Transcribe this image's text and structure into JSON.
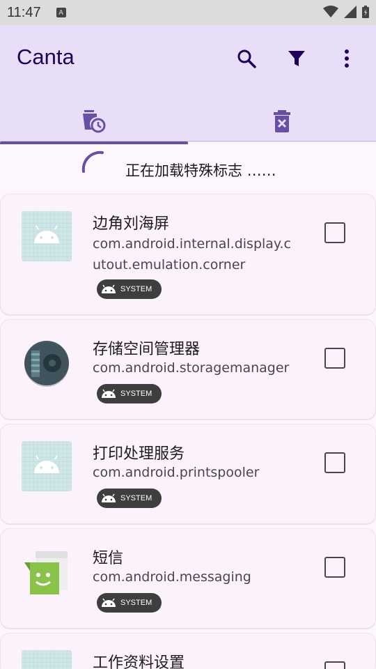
{
  "status_bar": {
    "time": "11:47",
    "notification_letter": "A"
  },
  "app_bar": {
    "title": "Canta",
    "actions": [
      "search-icon",
      "filter-icon",
      "more-vert-icon"
    ]
  },
  "tabs": [
    {
      "icon": "uninstall-scheduled-icon",
      "selected": true
    },
    {
      "icon": "delete-x-icon",
      "selected": false
    }
  ],
  "loading": {
    "text": "正在加载特殊标志 ……"
  },
  "apps": [
    {
      "name": "边角刘海屏",
      "package": "com.android.internal.display.cutout.emulation.corner",
      "badge": "SYSTEM",
      "icon": "android-default-icon",
      "checked": false
    },
    {
      "name": "存储空间管理器",
      "package": "com.android.storagemanager",
      "badge": "SYSTEM",
      "icon": "storage-manager-icon",
      "checked": false
    },
    {
      "name": "打印处理服务",
      "package": "com.android.printspooler",
      "badge": "SYSTEM",
      "icon": "android-default-icon",
      "checked": false
    },
    {
      "name": "短信",
      "package": "com.android.messaging",
      "badge": "SYSTEM",
      "icon": "messaging-icon",
      "checked": false
    },
    {
      "name": "工作资料设置",
      "package": "",
      "badge": "",
      "icon": "android-default-icon",
      "checked": false
    }
  ],
  "colors": {
    "app_bar": "#e8def8",
    "accent": "#6750a4",
    "title": "#21005d",
    "background": "#fdf7fd"
  }
}
